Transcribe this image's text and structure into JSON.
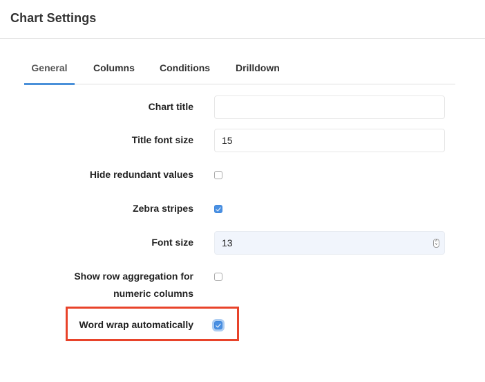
{
  "dialog": {
    "title": "Chart Settings"
  },
  "tabs": [
    {
      "label": "General",
      "active": true
    },
    {
      "label": "Columns",
      "active": false
    },
    {
      "label": "Conditions",
      "active": false
    },
    {
      "label": "Drilldown",
      "active": false
    }
  ],
  "form": {
    "chart_title": {
      "label": "Chart title",
      "value": "",
      "placeholder": ""
    },
    "title_font_size": {
      "label": "Title font size",
      "value": "15"
    },
    "hide_redundant_values": {
      "label": "Hide redundant values",
      "checked": false
    },
    "zebra_stripes": {
      "label": "Zebra stripes",
      "checked": true
    },
    "font_size": {
      "label": "Font size",
      "value": "13",
      "icon": "stepper-updown-icon"
    },
    "show_row_aggregation": {
      "label_line1": "Show row aggregation for",
      "label_line2": "numeric columns",
      "checked": false
    },
    "word_wrap": {
      "label": "Word wrap automatically",
      "checked": true,
      "highlighted": true
    }
  },
  "colors": {
    "accent": "#4a90e2",
    "highlight": "#e8432a",
    "tab_underline": "#4a90d9"
  }
}
